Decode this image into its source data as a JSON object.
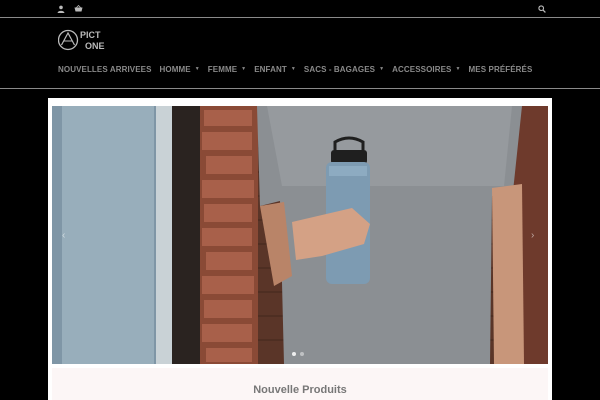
{
  "topbar": {
    "icons": [
      "user-icon",
      "cart-icon",
      "search-icon"
    ]
  },
  "header": {
    "logo_text_line1": "PICT",
    "logo_text_line2": "ONE"
  },
  "nav": {
    "items": [
      {
        "label": "NOUVELLES ARRIVEES",
        "has_dropdown": false
      },
      {
        "label": "HOMME",
        "has_dropdown": true
      },
      {
        "label": "FEMME",
        "has_dropdown": true
      },
      {
        "label": "ENFANT",
        "has_dropdown": true
      },
      {
        "label": "SACS - BAGAGES",
        "has_dropdown": true
      },
      {
        "label": "ACCESSOIRES",
        "has_dropdown": true
      },
      {
        "label": "MES PRÉFÉRÉS",
        "has_dropdown": false
      }
    ],
    "caret": "▼"
  },
  "slider": {
    "prev_arrow": "‹",
    "next_arrow": "›",
    "slide_count": 2,
    "active_slide": 1
  },
  "products": {
    "section_title": "Nouvelle Produits"
  },
  "colors": {
    "background": "#000000",
    "nav_text": "#8a8a8a",
    "divider": "#8a8a8a",
    "products_bg": "#fcf6f6",
    "title_text": "#777777"
  }
}
